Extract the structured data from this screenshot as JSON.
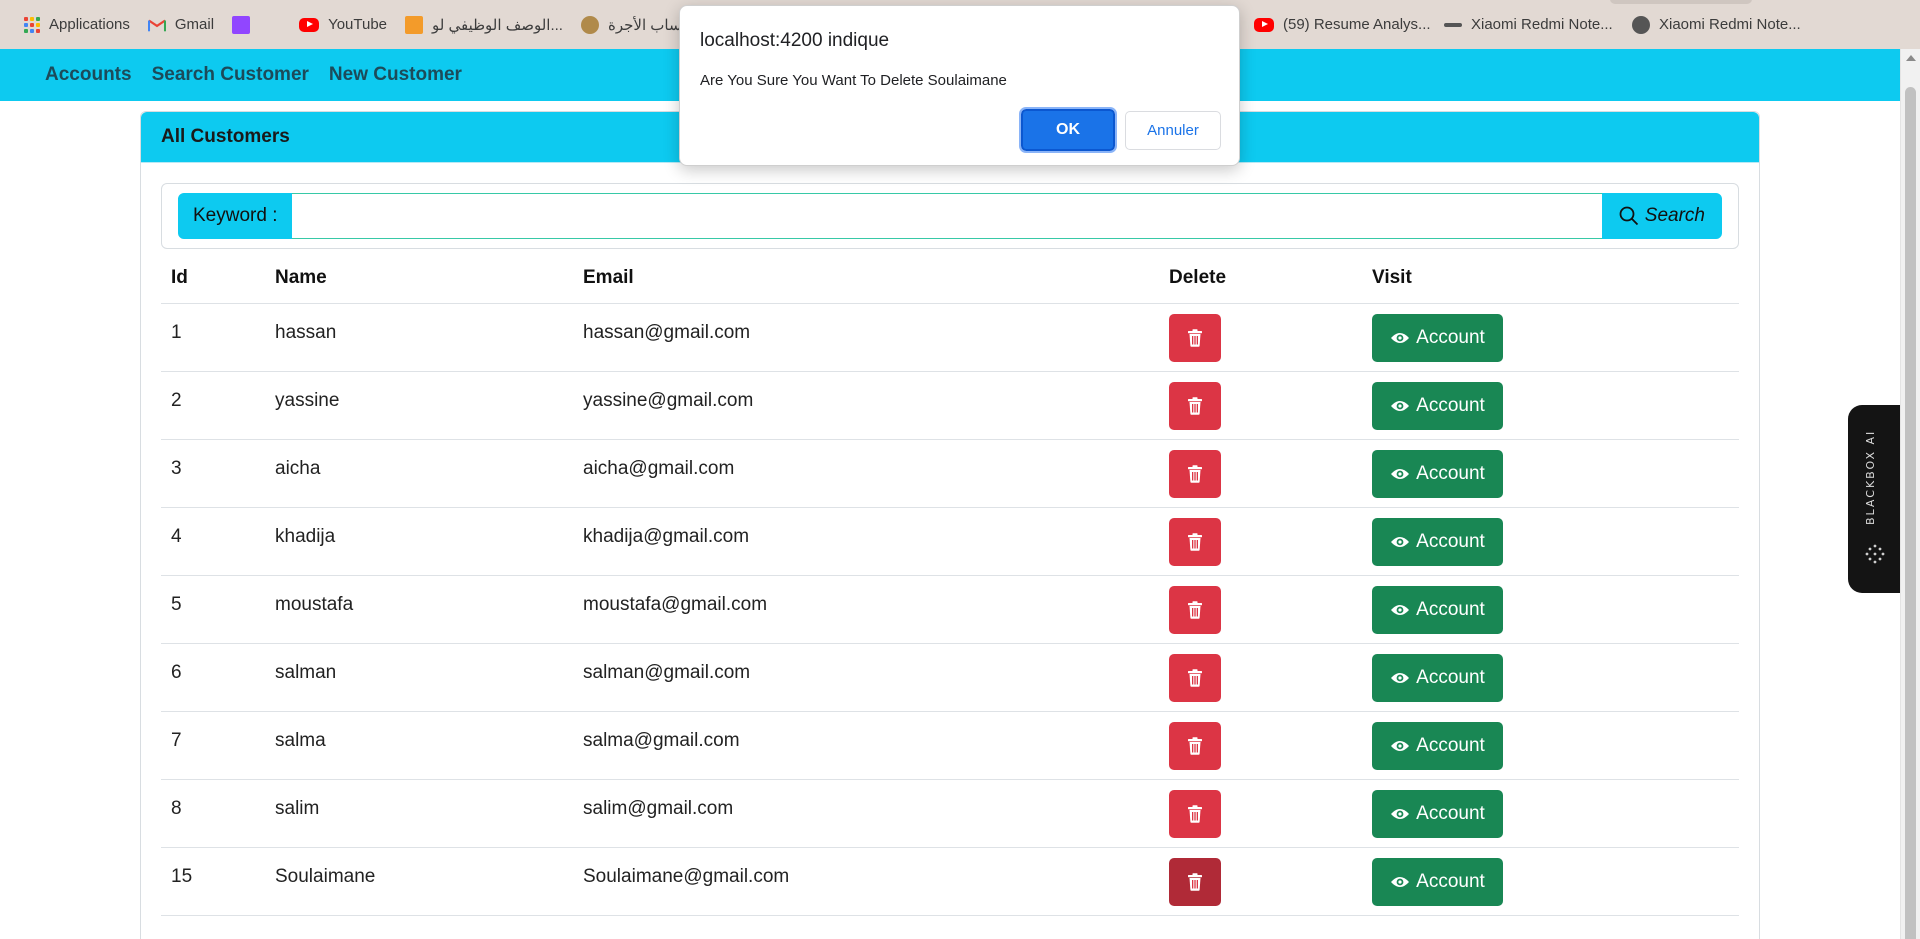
{
  "bookmarks": {
    "items": [
      {
        "label": "Applications",
        "icon": "apps-grid-icon"
      },
      {
        "label": "Gmail",
        "icon": "gmail-icon"
      },
      {
        "label": "",
        "icon": "twitch-icon"
      },
      {
        "label": "YouTube",
        "icon": "youtube-icon"
      },
      {
        "label": "الوصف الوظيفي لو...",
        "icon": "orange-site-icon"
      },
      {
        "label": "حساب الأجرة",
        "icon": "emblem-icon"
      },
      {
        "label": "(59) Resume Analys...",
        "icon": "youtube-icon"
      },
      {
        "label": "Xiaomi Redmi Note...",
        "icon": "dash-icon"
      },
      {
        "label": "Xiaomi Redmi Note...",
        "icon": "globe-icon"
      }
    ]
  },
  "navbar": {
    "links": [
      "Accounts",
      "Search Customer",
      "New Customer"
    ]
  },
  "card": {
    "title": "All Customers",
    "search": {
      "label": "Keyword :",
      "value": "",
      "button_label": "Search"
    },
    "table": {
      "headers": {
        "id": "Id",
        "name": "Name",
        "email": "Email",
        "delete": "Delete",
        "visit": "Visit"
      },
      "account_label": "Account",
      "rows": [
        {
          "id": "1",
          "name": "hassan",
          "email": "hassan@gmail.com"
        },
        {
          "id": "2",
          "name": "yassine",
          "email": "yassine@gmail.com"
        },
        {
          "id": "3",
          "name": "aicha",
          "email": "aicha@gmail.com"
        },
        {
          "id": "4",
          "name": "khadija",
          "email": "khadija@gmail.com"
        },
        {
          "id": "5",
          "name": "moustafa",
          "email": "moustafa@gmail.com"
        },
        {
          "id": "6",
          "name": "salman",
          "email": "salman@gmail.com"
        },
        {
          "id": "7",
          "name": "salma",
          "email": "salma@gmail.com"
        },
        {
          "id": "8",
          "name": "salim",
          "email": "salim@gmail.com"
        },
        {
          "id": "15",
          "name": "Soulaimane",
          "email": "Soulaimane@gmail.com"
        }
      ]
    }
  },
  "dialog": {
    "title": "localhost:4200 indique",
    "message": "Are You Sure You Want To Delete Soulaimane",
    "ok_label": "OK",
    "cancel_label": "Annuler"
  },
  "widget": {
    "label": "BLACKBOX AI"
  },
  "colors": {
    "navbar": "#0dcaf0",
    "delete": "#dc3545",
    "account": "#198754",
    "dialog_ok": "#1a73e8"
  }
}
